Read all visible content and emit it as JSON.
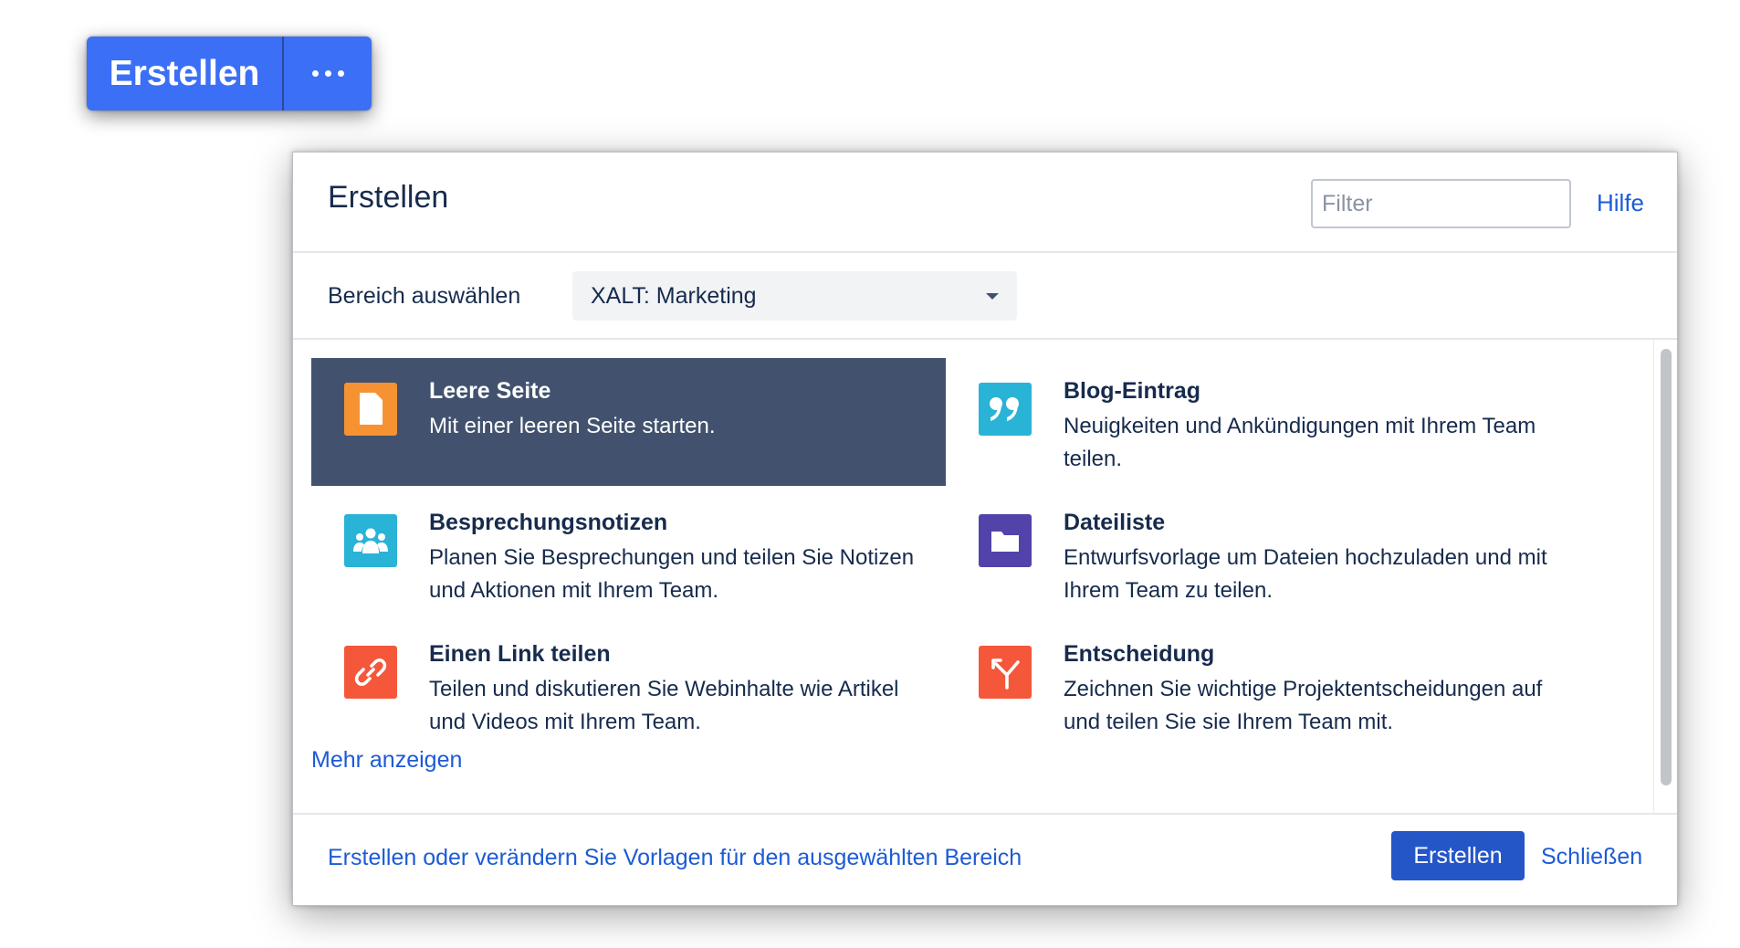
{
  "top_button": {
    "label": "Erstellen",
    "more_icon": "ellipsis-icon"
  },
  "dialog": {
    "title": "Erstellen",
    "filter_placeholder": "Filter",
    "help_label": "Hilfe",
    "space": {
      "label": "Bereich auswählen",
      "selected": "XALT: Marketing"
    },
    "templates": [
      {
        "title": "Leere Seite",
        "description": "Mit einer leeren Seite starten.",
        "icon": "blank-page-icon",
        "color": "#f79232",
        "selected": true
      },
      {
        "title": "Blog-Eintrag",
        "description": "Neuigkeiten und Ankündigungen mit Ihrem Team teilen.",
        "icon": "quote-icon",
        "color": "#29b3d6"
      },
      {
        "title": "Besprechungsnotizen",
        "description": "Planen Sie Besprechungen und teilen Sie Notizen und Aktionen mit Ihrem Team.",
        "icon": "people-icon",
        "color": "#29b3d6"
      },
      {
        "title": "Dateiliste",
        "description": "Entwurfsvorlage um Dateien hochzuladen und mit Ihrem Team zu teilen.",
        "icon": "folder-icon",
        "color": "#5243aa"
      },
      {
        "title": "Einen Link teilen",
        "description": "Teilen und diskutieren Sie Webinhalte wie Artikel und Videos mit Ihrem Team.",
        "icon": "link-icon",
        "color": "#f4573a"
      },
      {
        "title": "Entscheidung",
        "description": "Zeichnen Sie wichtige Projektentscheidungen auf und teilen Sie sie Ihrem Team mit.",
        "icon": "decision-icon",
        "color": "#f4573a"
      }
    ],
    "more_label": "Mehr anzeigen",
    "footer": {
      "templates_link": "Erstellen oder verändern Sie Vorlagen für den ausgewählten Bereich",
      "create_label": "Erstellen",
      "close_label": "Schließen"
    }
  }
}
